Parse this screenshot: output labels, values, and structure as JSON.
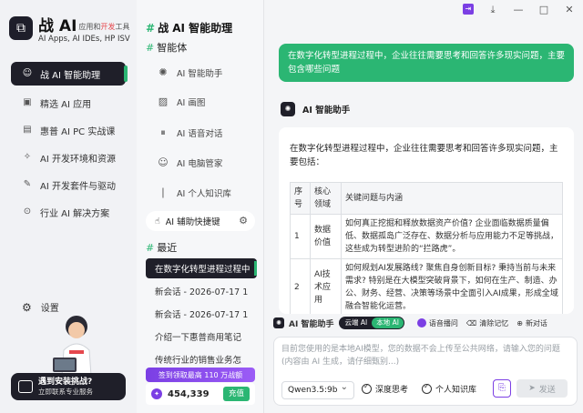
{
  "brand": {
    "logo_glyph": "⧉",
    "title": "战 AI",
    "tagline_prefix": "应用和",
    "tagline_highlight": "开发",
    "tagline_suffix": "工具",
    "subtitle": "AI Apps, AI IDEs, HP ISV"
  },
  "nav": {
    "items": [
      {
        "label": "战 AI 智能助理",
        "icon": "chat-icon",
        "glyph": "☺",
        "active": true
      },
      {
        "label": "精选 AI 应用",
        "icon": "apps-icon",
        "glyph": "▣",
        "active": false
      },
      {
        "label": "惠普 AI PC 实战课",
        "icon": "course-icon",
        "glyph": "▤",
        "active": false
      },
      {
        "label": "AI 开发环境和资源",
        "icon": "code-icon",
        "glyph": "✧",
        "active": false
      },
      {
        "label": "AI 开发套件与驱动",
        "icon": "toolkit-icon",
        "glyph": "✎",
        "active": false
      },
      {
        "label": "行业 AI 解决方案",
        "icon": "solution-icon",
        "glyph": "⊙",
        "active": false
      }
    ],
    "settings_label": "设置",
    "install_title": "遇到安装挑战?",
    "install_sub": "立即联系专业服务"
  },
  "mid": {
    "title": "战 AI 智能助理",
    "agents_section": "智能体",
    "agents": [
      {
        "label": "AI 智能助手",
        "icon": "assistant-icon",
        "glyph": "✺"
      },
      {
        "label": "AI 画图",
        "icon": "image-icon",
        "glyph": "▨"
      },
      {
        "label": "AI 语音对话",
        "icon": "voice-icon",
        "glyph": "⏸"
      },
      {
        "label": "AI 电脑管家",
        "icon": "pc-manager-icon",
        "glyph": "☺"
      },
      {
        "label": "AI 个人知识库",
        "icon": "knowledge-icon",
        "glyph": "❘"
      }
    ],
    "shortcut_label": "AI 辅助快捷键",
    "recent_section": "最近",
    "recent": [
      {
        "label": "在数字化转型进程过程中",
        "active": true
      },
      {
        "label": "新会话 - 2026-07-17 1",
        "active": false
      },
      {
        "label": "新会话 - 2026-07-17 1",
        "active": false
      },
      {
        "label": "介绍一下惠普商用笔记",
        "active": false
      },
      {
        "label": "传统行业的销售业务怎",
        "active": false
      }
    ],
    "promo": "签到领取最高 110 万战额",
    "points": "454,339",
    "recharge": "充值"
  },
  "chat": {
    "user_message": "在数字化转型进程过程中，企业往往需要思考和回答许多现实问题，主要包含哪些问题",
    "assistant_name": "AI 智能助手",
    "assistant_intro": "在数字化转型进程过程中，企业往往需要思考和回答许多现实问题，主要包括：",
    "table": {
      "headers": [
        "序号",
        "核心领域",
        "关键问题与内涵"
      ],
      "rows": [
        [
          "1",
          "数据价值",
          "如何真正挖掘和释放数据资产价值? 企业面临数据质量偏低、数据孤岛广泛存在、数据分析与应用能力不足等挑战，这些成为转型进阶的“拦路虎”。"
        ],
        [
          "2",
          "AI技术应用",
          "如何规划AI发展路线? 聚焦自身创新目标? 秉持当前与未来需求? 特别是在大模型突破背景下，如何在生产、制造、办公、财务、经营、决策等场景中全面引入AI成果，形成全域融合智能化运营。"
        ]
      ]
    }
  },
  "composer": {
    "agent_label": "AI 智能助手",
    "mode_cloud": "云端 AI",
    "mode_local": "本地 AI",
    "tool_voice": "语音播问",
    "tool_clear": "清除记忆",
    "tool_new": "新对话",
    "placeholder": "目前您使用的是本地AI模型，您的数据不会上传至公共网络，请输入您的问题 (内容由 AI 生成，请仔细甄别...)",
    "model": "Qwen3.5:9b",
    "deep_think": "深度思考",
    "knowledge": "个人知识库",
    "send": "发送"
  },
  "colors": {
    "accent_green": "#2bb673",
    "dark": "#1f1f29",
    "purple": "#7b3fe4"
  }
}
